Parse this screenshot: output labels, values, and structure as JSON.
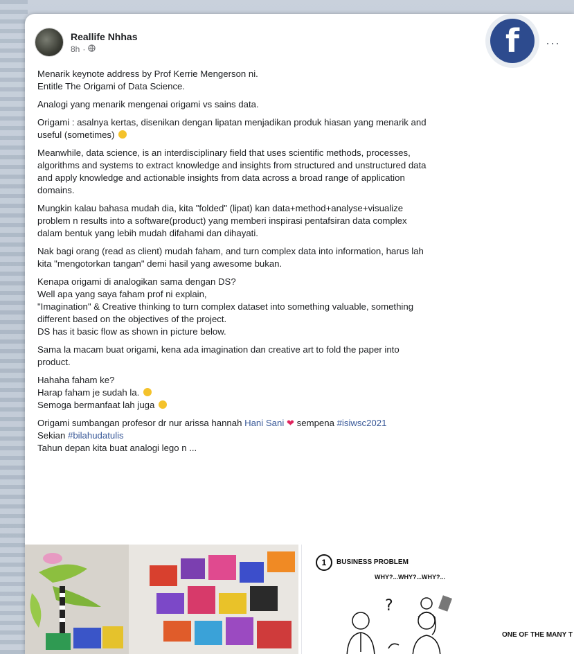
{
  "post": {
    "author": "Reallife Nhhas",
    "time": "8h",
    "privacy_icon": "globe-icon",
    "more_icon": "more-options-icon",
    "badge_letter": "f",
    "paragraphs": [
      [
        "Menarik keynote address by Prof Kerrie Mengerson ni.",
        "Entitle The Origami of Data Science."
      ],
      [
        "Analogi yang menarik mengenai origami vs sains data."
      ],
      [
        "Origami : asalnya kertas, disenikan dengan lipatan menjadikan produk hiasan yang menarik and",
        "useful (sometimes)"
      ],
      [
        "Meanwhile, data science,  is an interdisciplinary field that uses scientific methods, processes,",
        "algorithms and systems to extract knowledge and insights from structured and unstructured data",
        "and apply knowledge and actionable insights from data across a broad range of application",
        "domains."
      ],
      [
        "Mungkin kalau bahasa mudah dia, kita \"folded\" (lipat) kan data+method+analyse+visualize",
        "problem n results into a software(product) yang memberi inspirasi pentafsiran data complex",
        "dalam bentuk yang lebih mudah difahami dan dihayati."
      ],
      [
        "Nak bagi orang (read as client) mudah faham, and turn complex data into information, harus lah",
        "kita \"mengotorkan tangan\" demi hasil yang awesome bukan."
      ],
      [
        "Kenapa origami di analogikan sama dengan DS?",
        "Well apa yang saya faham prof ni explain,",
        "\"Imagination\" & Creative thinking to turn complex dataset into something valuable, something",
        "different based on the objectives of the project.",
        "DS has it basic flow as shown in picture below."
      ],
      [
        "Sama la macam buat origami, kena ada imagination dan creative art to fold the paper into",
        "product."
      ],
      [
        "Hahaha faham ke?",
        "Harap faham je sudah la.",
        "Semoga bermanfaat lah juga"
      ]
    ],
    "mention_line": {
      "prefix": "Origami sumbangan profesor dr nur arissa hannah ",
      "mention": "Hani Sani",
      "middle": " sempena ",
      "hashtag": "#isiwsc2021"
    },
    "sekian_prefix": "Sekian ",
    "sekian_hashtag": "#bilahudatulis",
    "last_line": "Tahun depan kita buat analogi lego n ..."
  },
  "media": {
    "left_alt": "lego-photo",
    "right_number": "1",
    "right_title": "BUSINESS PROBLEM",
    "right_sub": "WHY?...WHY?...WHY?...",
    "right_bottom": "ONE OF THE MANY T"
  }
}
